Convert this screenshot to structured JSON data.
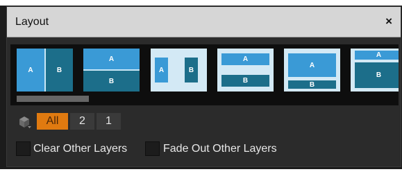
{
  "window": {
    "title": "Layout",
    "close_label": "×"
  },
  "layouts": [
    {
      "name": "side-by-side",
      "regions": [
        "A",
        "B"
      ]
    },
    {
      "name": "top-bottom",
      "regions": [
        "A",
        "B"
      ]
    },
    {
      "name": "framed-side-by-side",
      "regions": [
        "A",
        "B"
      ]
    },
    {
      "name": "framed-stacked-equal",
      "regions": [
        "A",
        "B"
      ]
    },
    {
      "name": "framed-large-top",
      "regions": [
        "A",
        "B"
      ]
    },
    {
      "name": "framed-large-bottom",
      "regions": [
        "A",
        "B"
      ]
    }
  ],
  "filters": {
    "all": "All",
    "two": "2",
    "one": "1",
    "selected": "All"
  },
  "options": {
    "clear_other_layers": {
      "label": "Clear Other Layers",
      "checked": false
    },
    "fade_out_other_layers": {
      "label": "Fade Out Other Layers",
      "checked": false
    }
  },
  "colors": {
    "accent": "#e07a10",
    "region_light": "#3a9ad6",
    "region_dark": "#1c6e8a",
    "frame": "#d3e9f5",
    "panel": "#2b2b2b",
    "titlebar": "#d6d6d6"
  },
  "icons": {
    "filter": "cube-filter-icon",
    "close": "close-icon"
  }
}
